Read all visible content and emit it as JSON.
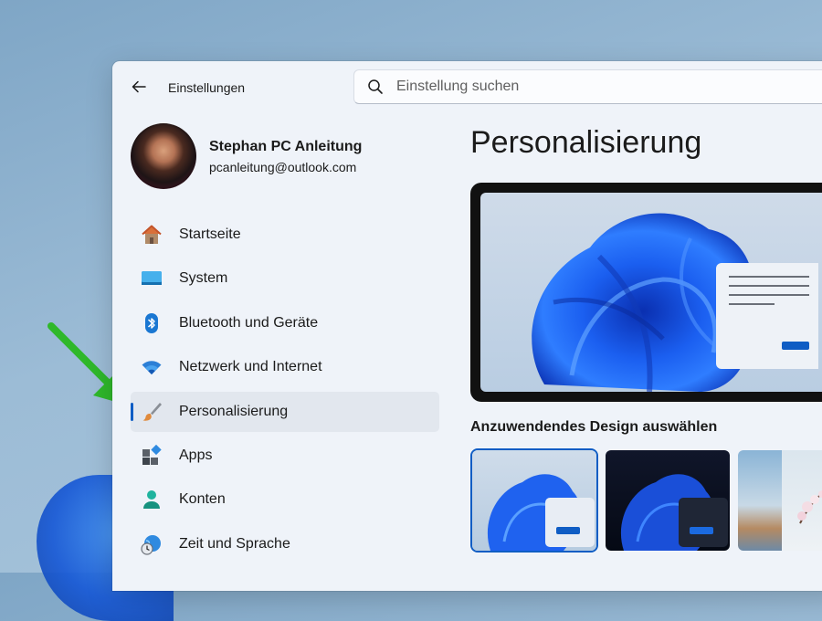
{
  "window": {
    "title": "Einstellungen"
  },
  "search": {
    "placeholder": "Einstellung suchen"
  },
  "profile": {
    "name": "Stephan PC Anleitung",
    "email": "pcanleitung@outlook.com"
  },
  "sidebar": {
    "items": [
      {
        "label": "Startseite",
        "icon": "home-icon"
      },
      {
        "label": "System",
        "icon": "system-monitor-icon"
      },
      {
        "label": "Bluetooth und Geräte",
        "icon": "bluetooth-icon"
      },
      {
        "label": "Netzwerk und Internet",
        "icon": "wifi-icon"
      },
      {
        "label": "Personalisierung",
        "icon": "paintbrush-icon",
        "active": true
      },
      {
        "label": "Apps",
        "icon": "apps-icon"
      },
      {
        "label": "Konten",
        "icon": "account-icon"
      },
      {
        "label": "Zeit und Sprache",
        "icon": "clock-globe-icon"
      }
    ]
  },
  "main": {
    "title": "Personalisierung",
    "themes_heading": "Anzuwendendes Design auswählen",
    "themes": [
      {
        "name": "light-bloom-theme",
        "selected": true
      },
      {
        "name": "dark-bloom-theme",
        "selected": false
      },
      {
        "name": "photo-landscape-theme",
        "selected": false
      }
    ]
  },
  "colors": {
    "accent": "#0f5dc4",
    "annotation_arrow": "#2fb82a",
    "window_bg": "#eff3f9"
  }
}
